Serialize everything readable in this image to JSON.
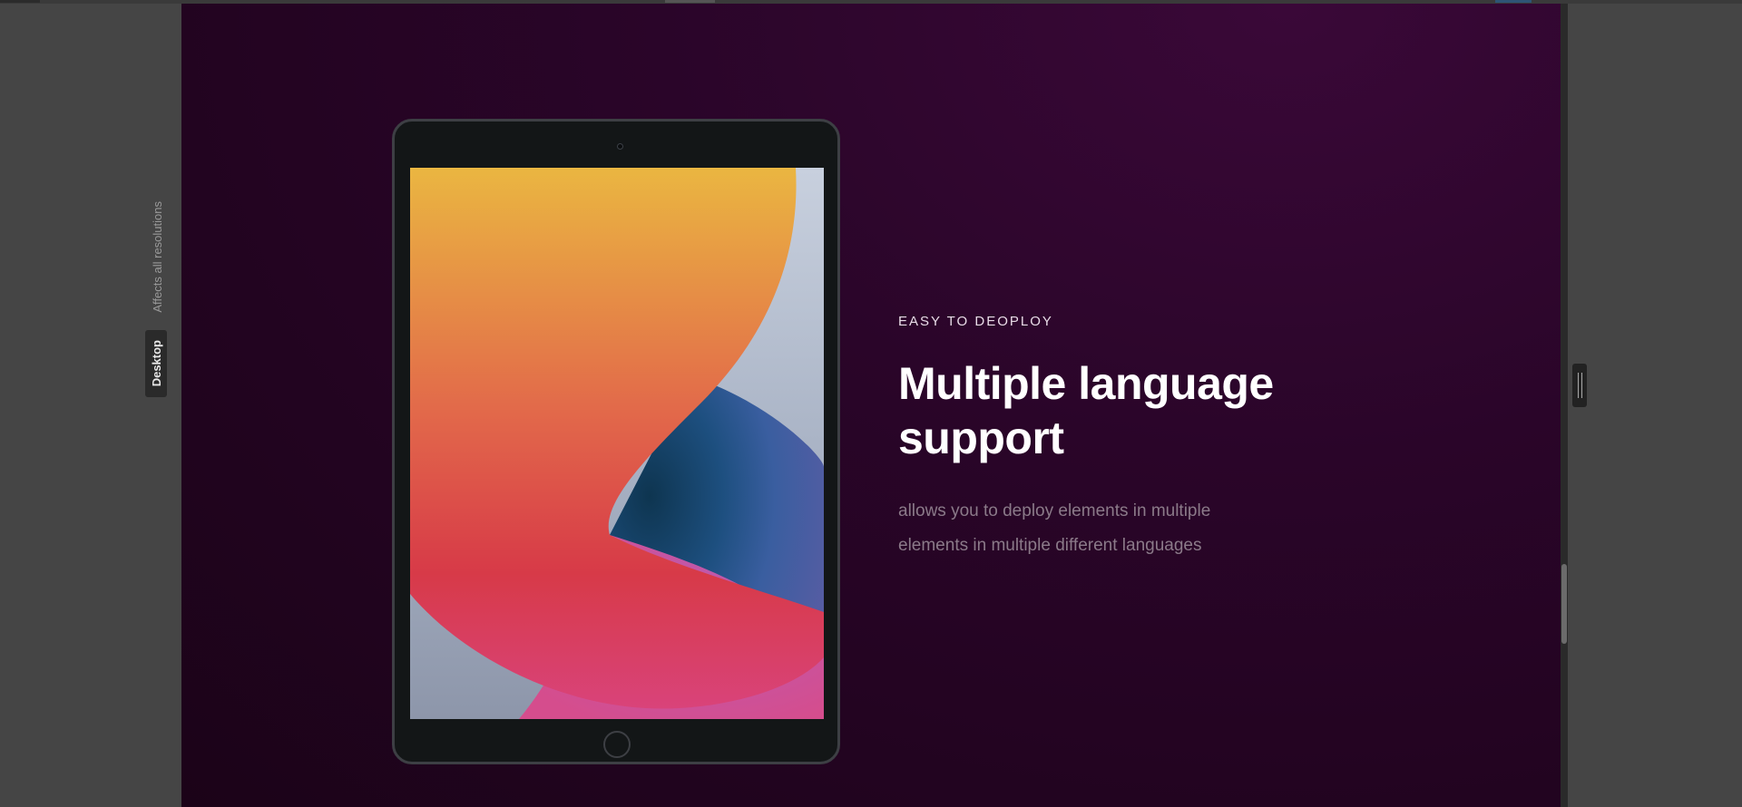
{
  "editor": {
    "affects_label": "Affects all resolutions",
    "device_tab": "Desktop"
  },
  "section": {
    "eyebrow": "EASY TO DEOPLOY",
    "headline": "Multiple language support",
    "description": "allows you to deploy elements in multiple elements in multiple different languages"
  },
  "colors": {
    "background_start": "#3a0838",
    "background_end": "#1b0318",
    "headline": "#ffffff",
    "description": "#8b7a89"
  },
  "icons": {
    "resize": "resize-handle-icon",
    "device": "ipad-mockup-image"
  }
}
